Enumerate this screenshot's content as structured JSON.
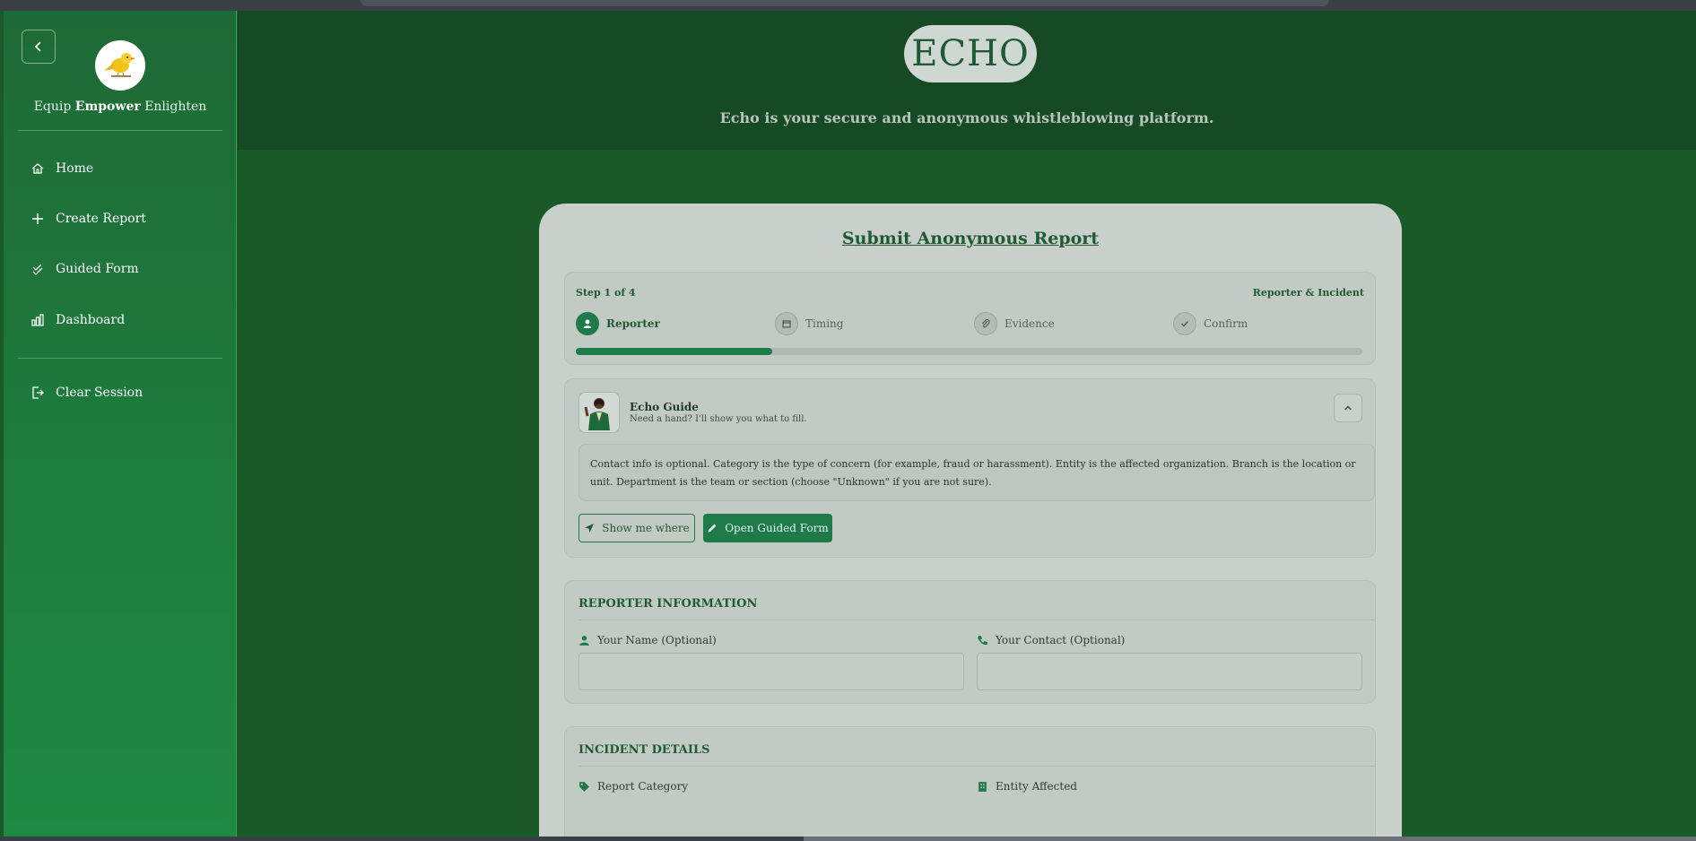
{
  "sidebar": {
    "tagline_pre": "Equip",
    "tagline_bold": "Empower",
    "tagline_post": "Enlighten",
    "nav": {
      "home": "Home",
      "create_report": "Create Report",
      "guided_form": "Guided Form",
      "dashboard": "Dashboard",
      "clear_session": "Clear Session"
    }
  },
  "header": {
    "brand": "ECHO",
    "subtitle": "Echo is your secure and anonymous whistleblowing platform."
  },
  "report": {
    "title": "Submit Anonymous Report",
    "step_counter": "Step 1 of 4",
    "step_name": "Reporter & Incident",
    "steps": [
      "Reporter",
      "Timing",
      "Evidence",
      "Confirm"
    ],
    "progress": 0.25,
    "guide": {
      "name": "Echo Guide",
      "subtitle": "Need a hand? I'll show you what to fill.",
      "text": "Contact info is optional. Category is the type of concern (for example, fraud or harassment). Entity is the affected organization. Branch is the location or unit. Department is the team or section (choose \"Unknown\" if you are not sure).",
      "show_me_where": "Show me where",
      "open_guided_form": "Open Guided Form"
    },
    "reporter_section": {
      "title": "REPORTER INFORMATION",
      "name_label": "Your Name (Optional)",
      "contact_label": "Your Contact (Optional)",
      "name_value": "",
      "contact_value": ""
    },
    "incident_section": {
      "title": "INCIDENT DETAILS",
      "category_label": "Report Category",
      "entity_label": "Entity Affected"
    }
  },
  "colors": {
    "brand_green": "#1f7a4a",
    "sidebar_top": "#1e6a36",
    "sidebar_bottom": "#1f8a43"
  }
}
